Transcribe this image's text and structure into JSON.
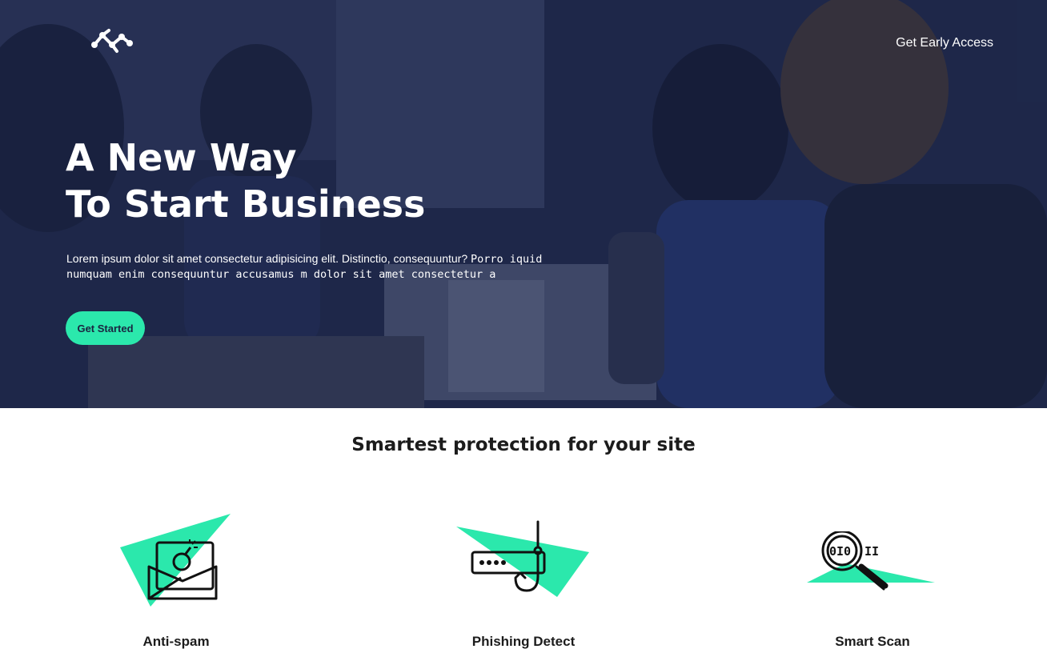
{
  "header": {
    "logo_icon": "network-nodes-icon",
    "nav_link": "Get Early Access"
  },
  "hero": {
    "title_line1": "A New Way",
    "title_line2": "To Start Business",
    "text_sans": "Lorem ipsum dolor sit amet consectetur adipisicing elit. Distinctio, consequuntur? ",
    "text_mono": "Porro iquid numquam enim consequuntur accusamus m dolor sit amet consectetur a",
    "cta_label": "Get Started"
  },
  "features": {
    "title": "Smartest protection for your site",
    "items": [
      {
        "label": "Anti-spam",
        "icon": "envelope-bomb-icon"
      },
      {
        "label": "Phishing Detect",
        "icon": "password-hook-icon"
      },
      {
        "label": "Smart Scan",
        "icon": "magnifier-binary-icon"
      }
    ]
  },
  "colors": {
    "accent": "#2be8ac",
    "hero_overlay": "#182146",
    "text_dark": "#1c1c1c"
  }
}
